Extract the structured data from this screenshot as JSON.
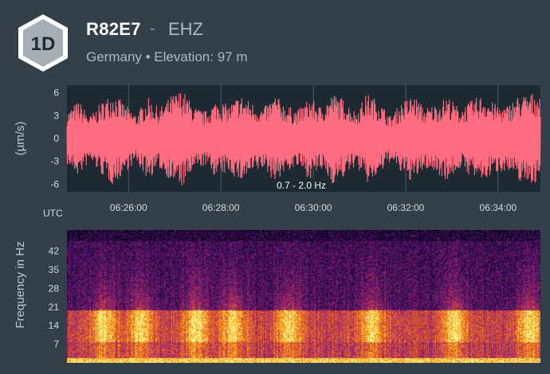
{
  "header": {
    "badge_label": "1D",
    "station_name": "R82E7",
    "separator": "-",
    "channel": "EHZ",
    "subtitle": "Germany • Elevation: 97 m"
  },
  "colors": {
    "background": "#344049",
    "waveform_line": "#ff6b7f",
    "plot_background": "#1e2a31",
    "badge_fill": "#a5aeb5",
    "badge_border": "#ffffff"
  },
  "chart_data": [
    {
      "type": "line",
      "title": "",
      "ylabel": "(µm/s)",
      "xlabel": "UTC",
      "annotation": "0.7 - 2.0 Hz",
      "ylim": [
        -7,
        7
      ],
      "y_ticks": [
        6,
        3,
        0,
        -3,
        -6
      ],
      "x_range": [
        "06:24:40",
        "06:34:55"
      ],
      "x_ticks": [
        "06:26:00",
        "06:28:00",
        "06:30:00",
        "06:32:00",
        "06:34:00"
      ],
      "grid": true,
      "series": [
        {
          "envelope_minutes": [
            0.0,
            0.25,
            0.5,
            0.75,
            1.0,
            1.25,
            1.5,
            1.75,
            2.0,
            2.25,
            2.5,
            2.75,
            3.0,
            3.25,
            3.5,
            3.75,
            4.0,
            4.25,
            4.5,
            4.75,
            5.0,
            5.25,
            5.5,
            5.75,
            6.0,
            6.25,
            6.5,
            6.75,
            7.0,
            7.25,
            7.5,
            7.75,
            8.0,
            8.25,
            8.5,
            8.75,
            9.0,
            9.25,
            9.5,
            9.75,
            10.25
          ],
          "envelope_amplitude": [
            3.5,
            5.0,
            3.0,
            4.8,
            6.2,
            4.5,
            3.2,
            5.4,
            4.0,
            5.6,
            6.5,
            4.2,
            3.6,
            5.2,
            4.4,
            5.8,
            4.8,
            4.0,
            5.8,
            4.4,
            3.8,
            5.4,
            4.2,
            6.0,
            5.2,
            3.6,
            6.0,
            5.0,
            3.0,
            4.8,
            5.8,
            4.0,
            4.6,
            5.6,
            4.0,
            5.0,
            5.8,
            4.6,
            4.2,
            5.6,
            6.2
          ]
        }
      ]
    },
    {
      "type": "heatmap",
      "title": "",
      "ylabel": "Frequency in Hz",
      "ylim": [
        0,
        50
      ],
      "y_ticks": [
        42,
        35,
        28,
        21,
        14,
        7
      ],
      "x_range": [
        "06:24:40",
        "06:34:55"
      ],
      "colormap": "inferno",
      "band_high_hz": [
        8,
        20
      ],
      "bright_bursts_minutes": [
        0.8,
        1.6,
        2.8,
        3.6,
        4.8,
        6.6,
        8.4,
        10.0
      ],
      "description_values": {
        "floor_power_rel": 0.18,
        "band_power_rel": 0.85
      }
    }
  ]
}
